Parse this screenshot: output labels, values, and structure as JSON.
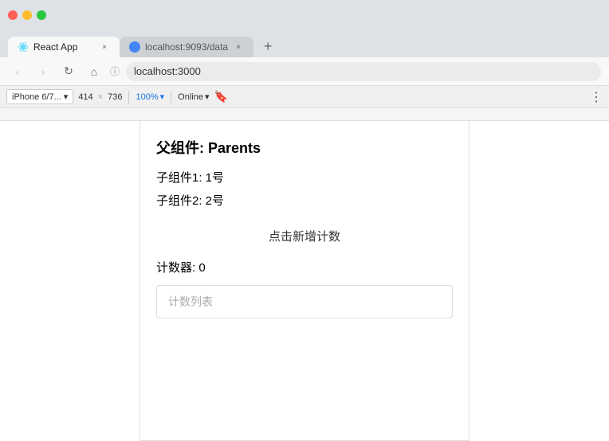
{
  "browser": {
    "tabs": [
      {
        "id": "tab-react",
        "label": "React App",
        "url": "localhost:3000",
        "favicon_type": "react",
        "active": true
      },
      {
        "id": "tab-data",
        "label": "localhost:9093/data",
        "url": "localhost:9093/data",
        "favicon_type": "globe",
        "active": false
      }
    ],
    "new_tab_label": "+",
    "address": "localhost:3000",
    "nav": {
      "back_label": "‹",
      "forward_label": "›",
      "reload_label": "↻",
      "home_label": "⌂"
    }
  },
  "device_toolbar": {
    "device_name": "iPhone 6/7...",
    "width": "414",
    "x_separator": "×",
    "height": "736",
    "zoom": "100%",
    "zoom_arrow": "▾",
    "online": "Online",
    "online_arrow": "▾",
    "more_options": "⋮"
  },
  "page": {
    "parent_title": "父组件: Parents",
    "child1_label": "子组件1: 1号",
    "child2_label": "子组件2: 2号",
    "click_btn_label": "点击新增计数",
    "counter_label": "计数器: 0",
    "count_list_placeholder": "计数列表"
  }
}
